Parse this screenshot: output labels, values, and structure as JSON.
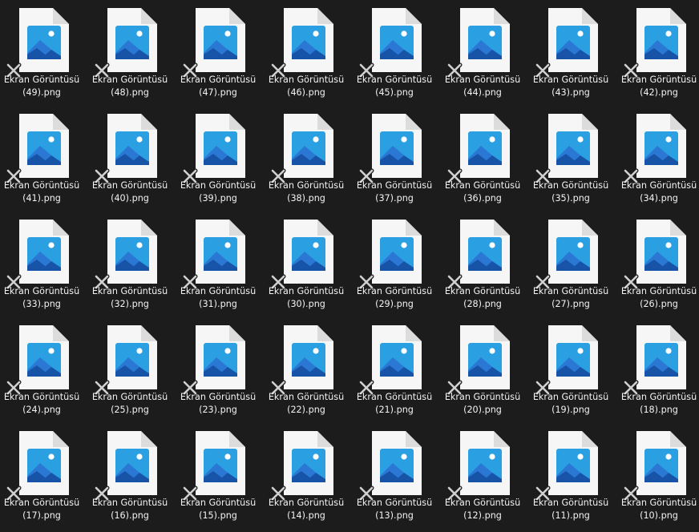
{
  "explorer": {
    "view": "large-icons",
    "file_icon": "image-file-icon",
    "overlay_icon": "broken-link-x-icon",
    "colors": {
      "background": "#1c1c1c",
      "page": "#f6f6f6",
      "fold": "#dcdcdc",
      "sky": "#2aa0e3",
      "mountain_back": "#2b78d4",
      "mountain_front": "#1754a8",
      "label": "#f2f2f2",
      "x_mark": "#d0d0d0"
    },
    "files": [
      {
        "line1": "Ekran Görüntüsü",
        "line2": "(49).png"
      },
      {
        "line1": "Ekran Görüntüsü",
        "line2": "(48).png"
      },
      {
        "line1": "Ekran Görüntüsü",
        "line2": "(47).png"
      },
      {
        "line1": "Ekran Görüntüsü",
        "line2": "(46).png"
      },
      {
        "line1": "Ekran Görüntüsü",
        "line2": "(45).png"
      },
      {
        "line1": "Ekran Görüntüsü",
        "line2": "(44).png"
      },
      {
        "line1": "Ekran Görüntüsü",
        "line2": "(43).png"
      },
      {
        "line1": "Ekran Görüntüsü",
        "line2": "(42).png"
      },
      {
        "line1": "Ekran Görüntüsü",
        "line2": "(41).png"
      },
      {
        "line1": "Ekran Görüntüsü",
        "line2": "(40).png"
      },
      {
        "line1": "Ekran Görüntüsü",
        "line2": "(39).png"
      },
      {
        "line1": "Ekran Görüntüsü",
        "line2": "(38).png"
      },
      {
        "line1": "Ekran Görüntüsü",
        "line2": "(37).png"
      },
      {
        "line1": "Ekran Görüntüsü",
        "line2": "(36).png"
      },
      {
        "line1": "Ekran Görüntüsü",
        "line2": "(35).png"
      },
      {
        "line1": "Ekran Görüntüsü",
        "line2": "(34).png"
      },
      {
        "line1": "Ekran Görüntüsü",
        "line2": "(33).png"
      },
      {
        "line1": "Ekran Görüntüsü",
        "line2": "(32).png"
      },
      {
        "line1": "Ekran Görüntüsü",
        "line2": "(31).png"
      },
      {
        "line1": "Ekran Görüntüsü",
        "line2": "(30).png"
      },
      {
        "line1": "Ekran Görüntüsü",
        "line2": "(29).png"
      },
      {
        "line1": "Ekran Görüntüsü",
        "line2": "(28).png"
      },
      {
        "line1": "Ekran Görüntüsü",
        "line2": "(27).png"
      },
      {
        "line1": "Ekran Görüntüsü",
        "line2": "(26).png"
      },
      {
        "line1": "Ekran Görüntüsü",
        "line2": "(24).png"
      },
      {
        "line1": "Ekran Görüntüsü",
        "line2": "(25).png"
      },
      {
        "line1": "Ekran Görüntüsü",
        "line2": "(23).png"
      },
      {
        "line1": "Ekran Görüntüsü",
        "line2": "(22).png"
      },
      {
        "line1": "Ekran Görüntüsü",
        "line2": "(21).png"
      },
      {
        "line1": "Ekran Görüntüsü",
        "line2": "(20).png"
      },
      {
        "line1": "Ekran Görüntüsü",
        "line2": "(19).png"
      },
      {
        "line1": "Ekran Görüntüsü",
        "line2": "(18).png"
      },
      {
        "line1": "Ekran Görüntüsü",
        "line2": "(17).png"
      },
      {
        "line1": "Ekran Görüntüsü",
        "line2": "(16).png"
      },
      {
        "line1": "Ekran Görüntüsü",
        "line2": "(15).png"
      },
      {
        "line1": "Ekran Görüntüsü",
        "line2": "(14).png"
      },
      {
        "line1": "Ekran Görüntüsü",
        "line2": "(13).png"
      },
      {
        "line1": "Ekran Görüntüsü",
        "line2": "(12).png"
      },
      {
        "line1": "Ekran Görüntüsü",
        "line2": "(11).png"
      },
      {
        "line1": "Ekran Görüntüsü",
        "line2": "(10).png"
      }
    ]
  }
}
